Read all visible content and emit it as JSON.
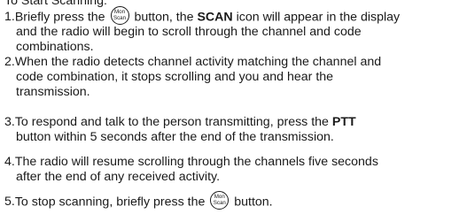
{
  "heading": "To Start Scanning:",
  "icon": {
    "name": "mon-scan-button-icon",
    "top_text": "Mon",
    "bottom_text": "Scan"
  },
  "steps": [
    {
      "number": "1.",
      "lines": [
        {
          "parts": [
            "Briefly press the ",
            "{icon}",
            " button, the ",
            "**SCAN**",
            " icon will appear in the display"
          ]
        },
        {
          "parts": [
            "and the radio will begin to scroll through the channel and code"
          ]
        },
        {
          "parts": [
            "combinations."
          ]
        }
      ]
    },
    {
      "number": "2.",
      "lines": [
        {
          "parts": [
            "When the radio detects channel activity matching the channel and"
          ]
        },
        {
          "parts": [
            "code combination, it stops scrolling and you and hear the"
          ]
        },
        {
          "parts": [
            "transmission."
          ]
        }
      ]
    },
    {
      "number": "3.",
      "lines": [
        {
          "parts": [
            "To respond and talk to the person transmitting, press the ",
            "**PTT**"
          ]
        },
        {
          "parts": [
            "button within 5 seconds after the end of the transmission."
          ]
        }
      ]
    },
    {
      "number": "4.",
      "lines": [
        {
          "parts": [
            "The radio will resume scrolling through the channels five seconds"
          ]
        },
        {
          "parts": [
            "after the end of any received activity."
          ]
        }
      ]
    },
    {
      "number": "5.",
      "lines": [
        {
          "parts": [
            "To stop scanning, briefly press the ",
            "{icon}",
            " button."
          ]
        }
      ]
    }
  ]
}
